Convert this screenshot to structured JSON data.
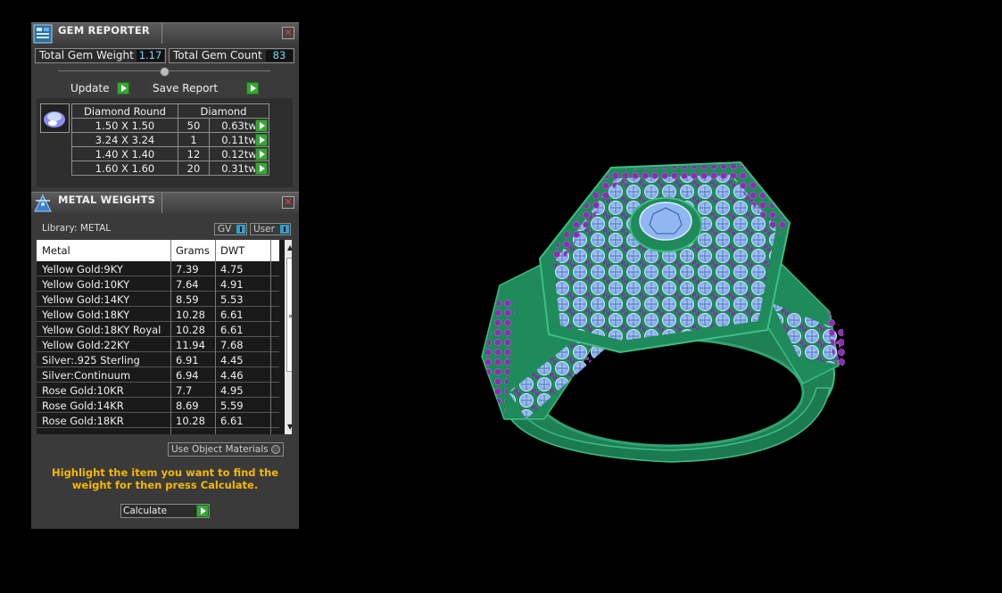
{
  "gem_reporter": {
    "title": "GEM REPORTER",
    "total_weight_label": "Total Gem Weight",
    "total_weight_value": "1.17",
    "total_count_label": "Total Gem Count",
    "total_count_value": "83",
    "update_label": "Update",
    "save_report_label": "Save Report",
    "gem_type": "Diamond Round",
    "gem_material": "Diamond",
    "rows": [
      {
        "size": "1.50 X 1.50",
        "count": "50",
        "weight": "0.63tw"
      },
      {
        "size": "3.24 X 3.24",
        "count": "1",
        "weight": "0.11tw"
      },
      {
        "size": "1.40 X 1.40",
        "count": "12",
        "weight": "0.12tw"
      },
      {
        "size": "1.60 X 1.60",
        "count": "20",
        "weight": "0.31tw"
      }
    ]
  },
  "metal_weights": {
    "title": "METAL WEIGHTS",
    "library_label": "Library: METAL",
    "gv_label": "GV",
    "user_label": "User",
    "headers": {
      "metal": "Metal",
      "grams": "Grams",
      "dwt": "DWT"
    },
    "rows": [
      {
        "metal": "Yellow Gold:9KY",
        "grams": "7.39",
        "dwt": "4.75"
      },
      {
        "metal": "Yellow Gold:10KY",
        "grams": "7.64",
        "dwt": "4.91"
      },
      {
        "metal": "Yellow Gold:14KY",
        "grams": "8.59",
        "dwt": "5.53"
      },
      {
        "metal": "Yellow Gold:18KY",
        "grams": "10.28",
        "dwt": "6.61"
      },
      {
        "metal": "Yellow Gold:18KY Royal",
        "grams": "10.28",
        "dwt": "6.61"
      },
      {
        "metal": "Yellow Gold:22KY",
        "grams": "11.94",
        "dwt": "7.68"
      },
      {
        "metal": "Silver:.925 Sterling",
        "grams": "6.91",
        "dwt": "4.45"
      },
      {
        "metal": "Silver:Continuum",
        "grams": "6.94",
        "dwt": "4.46"
      },
      {
        "metal": "Rose Gold:10KR",
        "grams": "7.7",
        "dwt": "4.95"
      },
      {
        "metal": "Rose Gold:14KR",
        "grams": "8.69",
        "dwt": "5.59"
      },
      {
        "metal": "Rose Gold:18KR",
        "grams": "10.28",
        "dwt": "6.61"
      }
    ],
    "use_object_materials_label": "Use Object Materials",
    "instruction": "Highlight the item you want to find the weight for then press Calculate.",
    "calculate_label": "Calculate"
  },
  "colors": {
    "accent_green": "#3aa43a",
    "value_blue": "#7fd4f5",
    "instruction_yellow": "#f5b800",
    "ring_metal": "#1f8a5a",
    "ring_stone": "#8fb8f2",
    "ring_prong": "#8a2fb0"
  }
}
